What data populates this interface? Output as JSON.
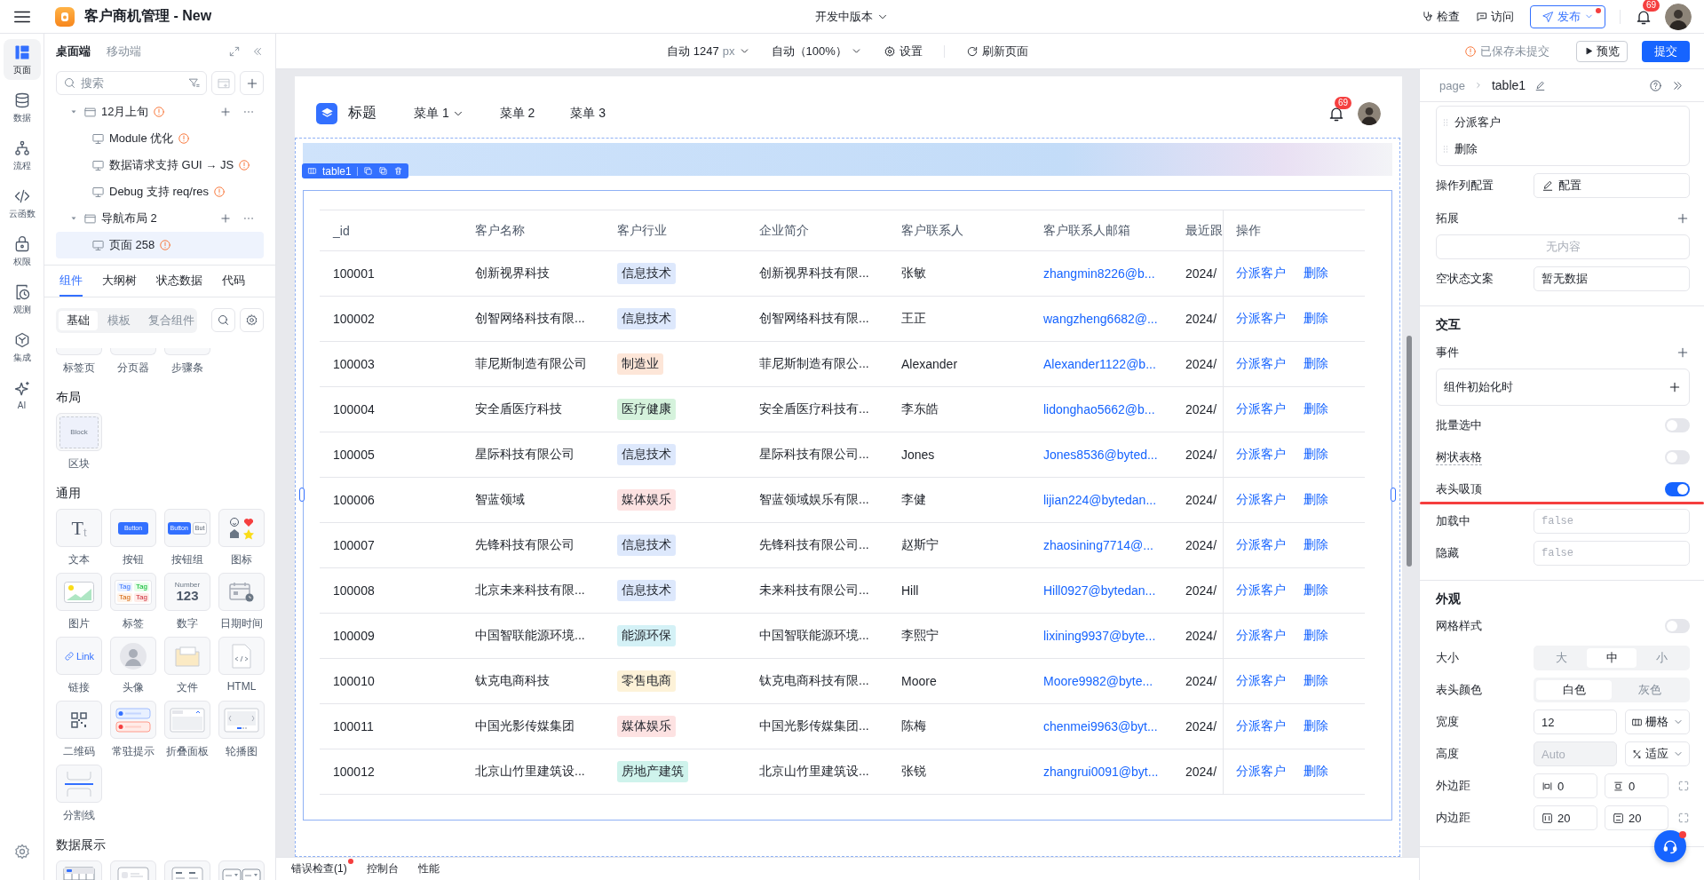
{
  "app": {
    "title": "客户商机管理 - New",
    "version": "开发中版本",
    "actions": [
      {
        "label": "检查",
        "kind": "inspect"
      },
      {
        "label": "访问",
        "kind": "visit"
      }
    ],
    "publish": {
      "label": "发布",
      "has_update": true
    },
    "notifications": "69"
  },
  "rail": [
    {
      "label": "页面",
      "kind": "pages",
      "selected": true
    },
    {
      "label": "数据",
      "kind": "data",
      "selected": false
    },
    {
      "label": "流程",
      "kind": "flow",
      "selected": false
    },
    {
      "label": "云函数",
      "kind": "function",
      "selected": false
    },
    {
      "label": "权限",
      "kind": "permission",
      "selected": false
    },
    {
      "label": "观测",
      "kind": "observe",
      "selected": false
    },
    {
      "label": "集成",
      "kind": "integrate",
      "selected": false
    },
    {
      "label": "AI",
      "kind": "ai",
      "selected": false
    }
  ],
  "left_panel": {
    "tabs": [
      {
        "label": "桌面端",
        "selected": true
      },
      {
        "label": "移动端",
        "selected": false
      }
    ],
    "search": {
      "placeholder": "搜索"
    },
    "tree": [
      {
        "label": "12月上旬",
        "kind": "folder",
        "warning": true,
        "expanded": true,
        "selected": false,
        "children": [
          {
            "label": "Module 优化",
            "kind": "page",
            "warning": true,
            "selected": false
          },
          {
            "label": "数据请求支持 GUI → JS",
            "kind": "page",
            "warning": true,
            "selected": false
          },
          {
            "label": "Debug 支持 req/res",
            "kind": "page",
            "warning": true,
            "selected": false
          }
        ]
      },
      {
        "label": "导航布局 2",
        "kind": "folder",
        "warning": false,
        "expanded": true,
        "selected": false,
        "children": [
          {
            "label": "页面 258",
            "kind": "page",
            "warning": true,
            "selected": true
          }
        ]
      }
    ],
    "component_tabs": [
      {
        "label": "组件",
        "selected": true
      },
      {
        "label": "大纲树",
        "selected": false
      },
      {
        "label": "状态数据",
        "selected": false
      },
      {
        "label": "代码",
        "selected": false
      }
    ],
    "category_tabs": [
      {
        "label": "基础",
        "selected": true
      },
      {
        "label": "模板",
        "selected": false
      },
      {
        "label": "复合组件",
        "selected": false
      }
    ],
    "clipped_items": [
      "标签页",
      "分页器",
      "步骤条"
    ],
    "groups": [
      {
        "title": "布局",
        "items": [
          {
            "label": "区块",
            "kind": "block",
            "preview": [
              "Block"
            ]
          }
        ]
      },
      {
        "title": "通用",
        "items": [
          {
            "label": "文本",
            "kind": "text",
            "preview": [
              "T$_{t}$"
            ]
          },
          {
            "label": "按钮",
            "kind": "button",
            "preview": [
              "Button"
            ]
          },
          {
            "label": "按钮组",
            "kind": "button_group",
            "preview": [
              "Button",
              "But"
            ]
          },
          {
            "label": "图标",
            "kind": "icon"
          },
          {
            "label": "图片",
            "kind": "image"
          },
          {
            "label": "标签",
            "kind": "tag",
            "preview": [
              "Tag",
              "Tag",
              "Tag",
              "Tag"
            ]
          },
          {
            "label": "数字",
            "kind": "number",
            "preview": [
              "Number",
              "123"
            ]
          },
          {
            "label": "日期时间",
            "kind": "datetime"
          },
          {
            "label": "链接",
            "kind": "link",
            "preview": [
              "Link"
            ]
          },
          {
            "label": "头像",
            "kind": "avatar"
          },
          {
            "label": "文件",
            "kind": "file"
          },
          {
            "label": "HTML",
            "kind": "html"
          },
          {
            "label": "二维码",
            "kind": "qrcode"
          },
          {
            "label": "常驻提示",
            "kind": "alert"
          },
          {
            "label": "折叠面板",
            "kind": "collapse"
          },
          {
            "label": "轮播图",
            "kind": "carousel"
          },
          {
            "label": "分割线",
            "kind": "divider"
          }
        ]
      },
      {
        "title": "数据展示",
        "items": [
          {
            "kind": "table"
          },
          {
            "kind": "list"
          },
          {
            "kind": "description"
          },
          {
            "kind": "select"
          }
        ]
      }
    ]
  },
  "toolbar": {
    "width": "自动 1247",
    "unit": "px",
    "zoom": "自动（100%）",
    "settings": "设置",
    "refresh": "刷新页面",
    "status": "已保存未提交",
    "preview": "预览",
    "submit": "提交"
  },
  "preview": {
    "title": "标题",
    "menus": [
      {
        "label": "菜单 1",
        "has_dropdown": true
      },
      {
        "label": "菜单 2",
        "has_dropdown": false
      },
      {
        "label": "菜单 3",
        "has_dropdown": false
      }
    ],
    "notifications": "69"
  },
  "table": {
    "name": "table1",
    "columns": [
      "_id",
      "客户名称",
      "客户行业",
      "企业简介",
      "客户联系人",
      "客户联系人邮箱",
      "最近跟",
      "操作"
    ],
    "rows": [
      {
        "id": "100001",
        "name": "创新视界科技",
        "industry": {
          "label": "信息技术",
          "color": "#dde8fc"
        },
        "intro": "创新视界科技有限...",
        "contact": "张敏",
        "email": "zhangmin8226@b...",
        "last": "2024/",
        "actions": [
          "分派客户",
          "删除"
        ]
      },
      {
        "id": "100002",
        "name": "创智网络科技有限...",
        "industry": {
          "label": "信息技术",
          "color": "#dde8fc"
        },
        "intro": "创智网络科技有限...",
        "contact": "王正",
        "email": "wangzheng6682@...",
        "last": "2024/",
        "actions": [
          "分派客户",
          "删除"
        ]
      },
      {
        "id": "100003",
        "name": "菲尼斯制造有限公司",
        "industry": {
          "label": "制造业",
          "color": "#fde6d8"
        },
        "intro": "菲尼斯制造有限公...",
        "contact": "Alexander",
        "email": "Alexander1122@b...",
        "last": "2024/",
        "actions": [
          "分派客户",
          "删除"
        ]
      },
      {
        "id": "100004",
        "name": "安全盾医疗科技",
        "industry": {
          "label": "医疗健康",
          "color": "#d5f2dc"
        },
        "intro": "安全盾医疗科技有...",
        "contact": "李东皓",
        "email": "lidonghao5662@b...",
        "last": "2024/",
        "actions": [
          "分派客户",
          "删除"
        ]
      },
      {
        "id": "100005",
        "name": "星际科技有限公司",
        "industry": {
          "label": "信息技术",
          "color": "#dde8fc"
        },
        "intro": "星际科技有限公司...",
        "contact": "Jones",
        "email": "Jones8536@byted...",
        "last": "2024/",
        "actions": [
          "分派客户",
          "删除"
        ]
      },
      {
        "id": "100006",
        "name": "智蓝领域",
        "industry": {
          "label": "媒体娱乐",
          "color": "#fde2e2"
        },
        "intro": "智蓝领域娱乐有限...",
        "contact": "李健",
        "email": "lijian224@bytedan...",
        "last": "2024/",
        "actions": [
          "分派客户",
          "删除"
        ]
      },
      {
        "id": "100007",
        "name": "先锋科技有限公司",
        "industry": {
          "label": "信息技术",
          "color": "#dde8fc"
        },
        "intro": "先锋科技有限公司...",
        "contact": "赵斯宁",
        "email": "zhaosining7714@...",
        "last": "2024/",
        "actions": [
          "分派客户",
          "删除"
        ]
      },
      {
        "id": "100008",
        "name": "北京未来科技有限...",
        "industry": {
          "label": "信息技术",
          "color": "#dde8fc"
        },
        "intro": "未来科技有限公司...",
        "contact": "Hill",
        "email": "Hill0927@bytedan...",
        "last": "2024/",
        "actions": [
          "分派客户",
          "删除"
        ]
      },
      {
        "id": "100009",
        "name": "中国智联能源环境...",
        "industry": {
          "label": "能源环保",
          "color": "#d4f1f6"
        },
        "intro": "中国智联能源环境...",
        "contact": "李熙宁",
        "email": "lixining9937@byte...",
        "last": "2024/",
        "actions": [
          "分派客户",
          "删除"
        ]
      },
      {
        "id": "100010",
        "name": "钛克电商科技",
        "industry": {
          "label": "零售电商",
          "color": "#fdf2d8"
        },
        "intro": "钛克电商科技有限...",
        "contact": "Moore",
        "email": "Moore9982@byte...",
        "last": "2024/",
        "actions": [
          "分派客户",
          "删除"
        ]
      },
      {
        "id": "100011",
        "name": "中国光影传媒集团",
        "industry": {
          "label": "媒体娱乐",
          "color": "#fde2e2"
        },
        "intro": "中国光影传媒集团...",
        "contact": "陈梅",
        "email": "chenmei9963@byt...",
        "last": "2024/",
        "actions": [
          "分派客户",
          "删除"
        ]
      },
      {
        "id": "100012",
        "name": "北京山竹里建筑设...",
        "industry": {
          "label": "房地产建筑",
          "color": "#cff3ec"
        },
        "intro": "北京山竹里建筑设...",
        "contact": "张锐",
        "email": "zhangrui0091@byt...",
        "last": "2024/",
        "actions": [
          "分派客户",
          "删除"
        ]
      }
    ]
  },
  "bottom_tabs": [
    {
      "label": "错误检查(1)",
      "alert": true
    },
    {
      "label": "控制台",
      "alert": false
    },
    {
      "label": "性能",
      "alert": false
    }
  ],
  "inspector": {
    "breadcrumb": [
      "page",
      "table1"
    ],
    "items": [
      {
        "kind": "action_list",
        "items": [
          "分派客户",
          "删除"
        ]
      },
      {
        "kind": "button_field",
        "label": "操作列配置",
        "value": "配置"
      },
      {
        "kind": "add_header",
        "label": "拓展"
      },
      {
        "kind": "empty_box",
        "text": "无内容"
      },
      {
        "kind": "input",
        "label": "空状态文案",
        "value": "暂无数据"
      },
      {
        "kind": "section",
        "label": "交互"
      },
      {
        "kind": "add_header",
        "label": "事件"
      },
      {
        "kind": "event",
        "label": "组件初始化时"
      },
      {
        "kind": "toggle",
        "label": "批量选中",
        "on": false,
        "hint": false,
        "highlighted": false
      },
      {
        "kind": "toggle",
        "label": "树状表格",
        "on": false,
        "hint": true,
        "highlighted": false
      },
      {
        "kind": "toggle",
        "label": "表头吸顶",
        "on": true,
        "hint": false,
        "highlighted": true
      },
      {
        "kind": "code_input",
        "label": "加载中",
        "placeholder": "false"
      },
      {
        "kind": "code_input",
        "label": "隐藏",
        "placeholder": "false"
      },
      {
        "kind": "section",
        "label": "外观"
      },
      {
        "kind": "toggle",
        "label": "网格样式",
        "on": false,
        "hint": false,
        "highlighted": false
      },
      {
        "kind": "segmented",
        "label": "大小",
        "options": [
          {
            "label": "大",
            "selected": false
          },
          {
            "label": "中",
            "selected": true
          },
          {
            "label": "小",
            "selected": false
          }
        ]
      },
      {
        "kind": "segmented",
        "label": "表头颜色",
        "options": [
          {
            "label": "白色",
            "selected": true
          },
          {
            "label": "灰色",
            "selected": false
          }
        ]
      },
      {
        "kind": "input_select",
        "label": "宽度",
        "value": "12",
        "disabled": false,
        "select": {
          "label": "栅格",
          "kind": "grid"
        }
      },
      {
        "kind": "input_select",
        "label": "高度",
        "placeholder": "Auto",
        "disabled": true,
        "select": {
          "label": "适应",
          "kind": "fit"
        }
      },
      {
        "kind": "spacing",
        "label": "外边距",
        "values": [
          {
            "value": "0",
            "kind": "horizontal"
          },
          {
            "value": "0",
            "kind": "vertical"
          }
        ]
      },
      {
        "kind": "spacing",
        "label": "内边距",
        "values": [
          {
            "value": "20",
            "kind": "inner_horizontal"
          },
          {
            "value": "20",
            "kind": "inner_vertical"
          }
        ]
      }
    ],
    "help": {
      "has_alert": true
    }
  }
}
